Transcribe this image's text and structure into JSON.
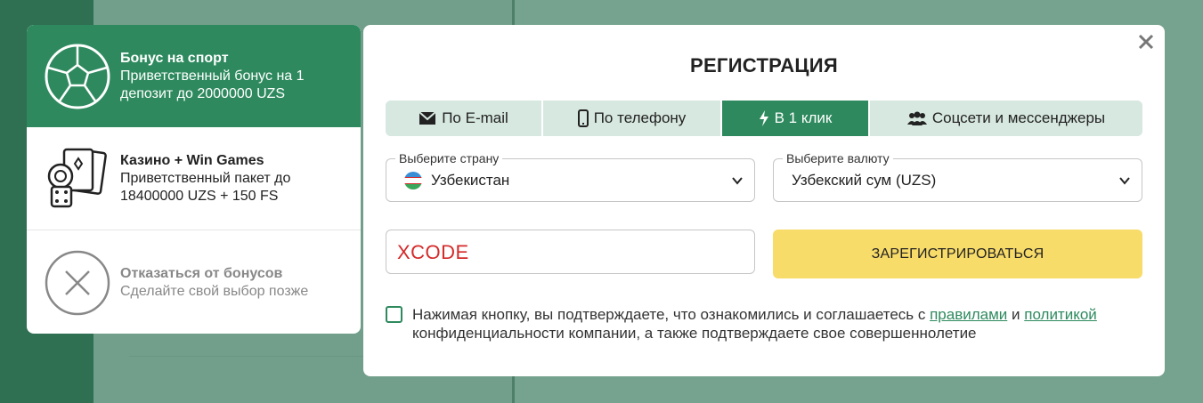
{
  "bonuses": [
    {
      "title": "Бонус на спорт",
      "desc": "Приветственный бонус на 1 депозит до 2000000 UZS",
      "icon": "soccer-ball-icon"
    },
    {
      "title": "Казино + Win Games",
      "desc": "Приветственный пакет до 18400000 UZS + 150 FS",
      "icon": "casino-cards-dice-icon"
    },
    {
      "title": "Отказаться от бонусов",
      "desc": "Сделайте свой выбор позже",
      "icon": "close-circle-icon"
    }
  ],
  "modal": {
    "title": "РЕГИСТРАЦИЯ",
    "close_icon": "close-icon",
    "tabs": [
      {
        "label": "По E-mail",
        "icon": "envelope-icon"
      },
      {
        "label": "По телефону",
        "icon": "phone-icon"
      },
      {
        "label": "В 1 клик",
        "icon": "lightning-icon",
        "active": true
      },
      {
        "label": "Соцсети и мессенджеры",
        "icon": "users-icon"
      }
    ],
    "country": {
      "label": "Выберите страну",
      "value": "Узбекистан",
      "icon": "uzbekistan-flag-icon"
    },
    "currency": {
      "label": "Выберите валюту",
      "value": "Узбекский сум (UZS)"
    },
    "promo_value": "XCODE",
    "register_label": "ЗАРЕГИСТРИРОВАТЬСЯ",
    "agree": {
      "text_before": "Нажимая кнопку, вы подтверждаете, что ознакомились и соглашаетесь с ",
      "link_rules": "правилами",
      "and": " и ",
      "link_policy": "политикой",
      "text_after": " конфиденциальности компании, а также подтверждаете свое совершеннолетие"
    }
  },
  "colors": {
    "accent": "#2e8a5e",
    "tab_bg": "#d7e8e0",
    "button": "#f8dc6a",
    "promo_text": "#d42a2a"
  }
}
